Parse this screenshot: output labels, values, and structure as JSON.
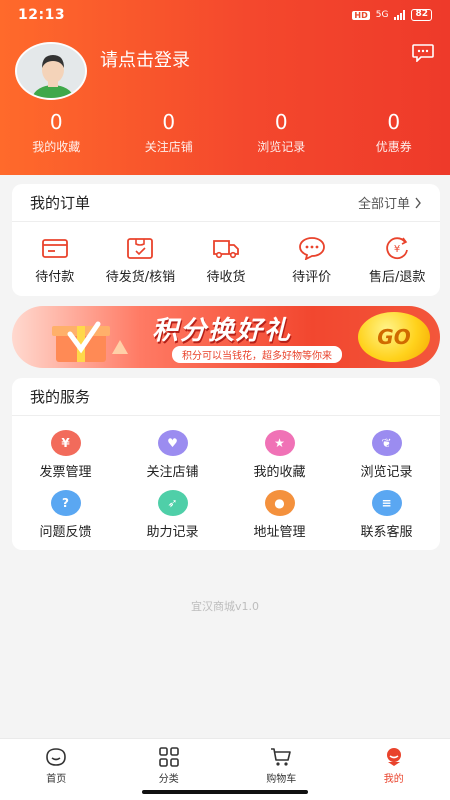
{
  "status_bar": {
    "time": "12:13",
    "network": "5G",
    "hd": "HD",
    "battery": "82"
  },
  "profile": {
    "login_prompt": "请点击登录"
  },
  "stats": [
    {
      "value": "0",
      "label": "我的收藏"
    },
    {
      "value": "0",
      "label": "关注店铺"
    },
    {
      "value": "0",
      "label": "浏览记录"
    },
    {
      "value": "0",
      "label": "优惠券"
    }
  ],
  "orders": {
    "title": "我的订单",
    "all_label": "全部订单",
    "items": [
      {
        "label": "待付款",
        "icon": "wallet-icon"
      },
      {
        "label": "待发货/核销",
        "icon": "package-icon"
      },
      {
        "label": "待收货",
        "icon": "truck-icon"
      },
      {
        "label": "待评价",
        "icon": "comment-icon"
      },
      {
        "label": "售后/退款",
        "icon": "refund-icon"
      }
    ]
  },
  "banner": {
    "title": "积分换好礼",
    "subtitle": "积分可以当钱花，超多好物等你来",
    "cta": "GO"
  },
  "services": {
    "title": "我的服务",
    "items": [
      {
        "label": "发票管理",
        "icon": "invoice-icon",
        "color": "#f26b5b"
      },
      {
        "label": "关注店铺",
        "icon": "heart-icon",
        "color": "#9b8cf0"
      },
      {
        "label": "我的收藏",
        "icon": "star-icon",
        "color": "#f072b6"
      },
      {
        "label": "浏览记录",
        "icon": "footprint-icon",
        "color": "#9b8cf0"
      },
      {
        "label": "问题反馈",
        "icon": "question-icon",
        "color": "#5aa7f2"
      },
      {
        "label": "助力记录",
        "icon": "rocket-icon",
        "color": "#4fcfa8"
      },
      {
        "label": "地址管理",
        "icon": "location-icon",
        "color": "#f4913d"
      },
      {
        "label": "联系客服",
        "icon": "service-icon",
        "color": "#5aa7f2"
      }
    ]
  },
  "version": "宜汉商城v1.0",
  "tabs": [
    {
      "label": "首页",
      "icon": "home-icon",
      "active": false
    },
    {
      "label": "分类",
      "icon": "category-icon",
      "active": false
    },
    {
      "label": "购物车",
      "icon": "cart-icon",
      "active": false
    },
    {
      "label": "我的",
      "icon": "profile-icon",
      "active": true
    }
  ],
  "colors": {
    "accent": "#e9432c",
    "header_start": "#ff6a2b",
    "header_end": "#ee3a2a"
  }
}
